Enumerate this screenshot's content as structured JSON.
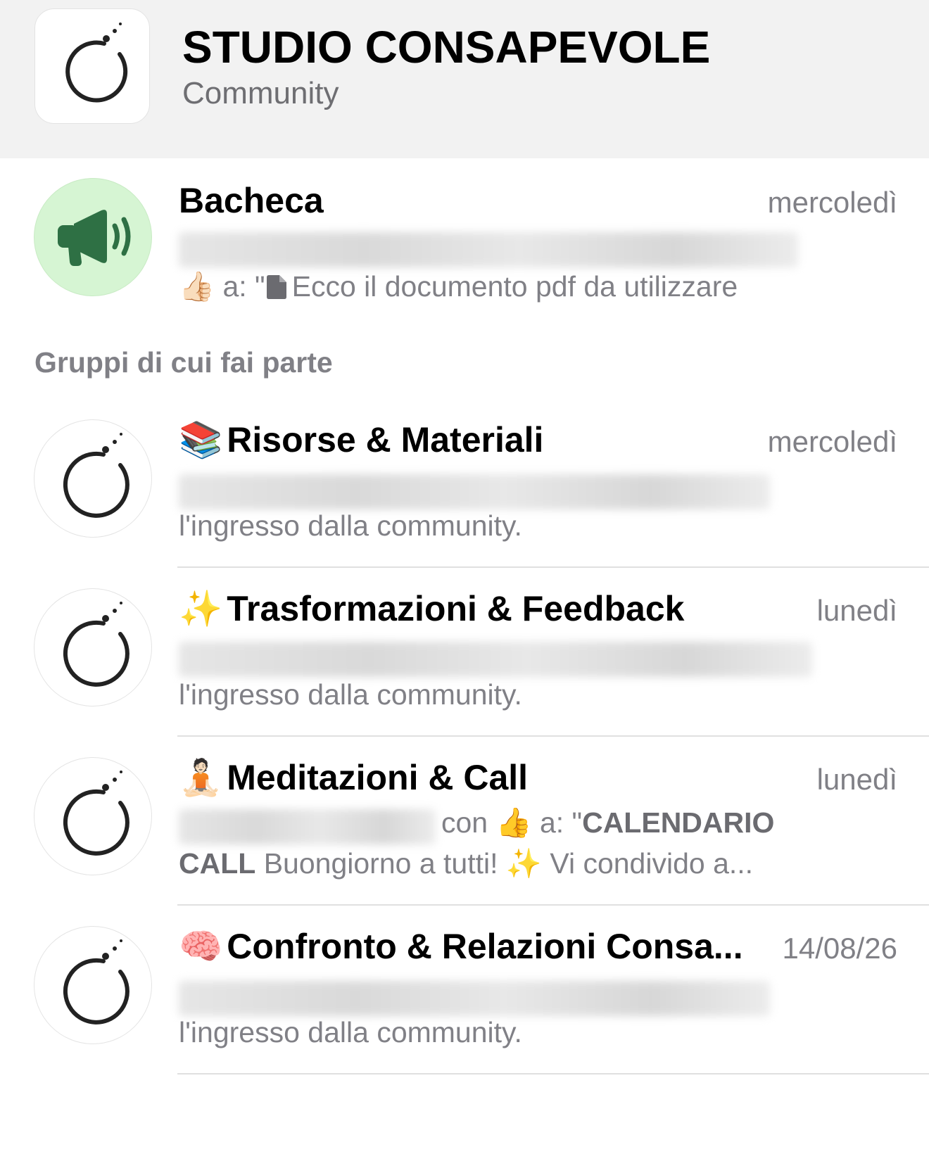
{
  "header": {
    "title": "STUDIO CONSAPEVOLE",
    "subtitle": "Community",
    "logo_icon": "community-logo-icon"
  },
  "announcement": {
    "title": "Bacheca",
    "time": "mercoledì",
    "preview_reaction": "👍🏻",
    "preview_text_1": " a: \"",
    "preview_text_2": "Ecco il documento pdf da utilizzare",
    "icon": "megaphone-icon",
    "icon_bg": "#d6f5d3",
    "icon_color": "#2e7044"
  },
  "section_label": "Gruppi di cui fai parte",
  "groups": [
    {
      "emoji": "📚",
      "title": "Risorse & Materiali",
      "time": "mercoledì",
      "preview": "l'ingresso dalla community."
    },
    {
      "emoji": "✨",
      "title": "Trasformazioni & Feedback",
      "time": "lunedì",
      "preview": "l'ingresso dalla community."
    },
    {
      "emoji": "🧘🏻",
      "title": "Meditazioni & Call",
      "time": "lunedì",
      "preview_line1_a": "con ",
      "preview_line1_reaction": "👍",
      "preview_line1_b": " a: \"",
      "preview_line1_bold": "CALENDARIO",
      "preview_line2_bold": "CALL",
      "preview_line2_a": " Buongiorno a tutti! ",
      "preview_line2_emoji": "✨",
      "preview_line2_b": " Vi condivido a..."
    },
    {
      "emoji": "🧠",
      "title": "Confronto & Relazioni Consa...",
      "time": "14/08/26",
      "preview": "l'ingresso dalla community."
    }
  ]
}
